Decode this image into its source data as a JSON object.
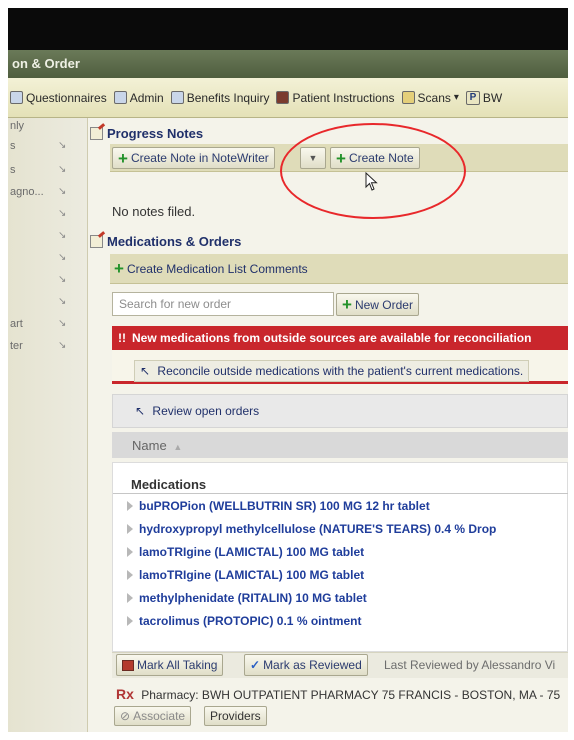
{
  "window": {
    "title": "on & Order"
  },
  "toolbar": {
    "items": [
      {
        "label": "Questionnaires",
        "icon": "questionnaire-icon"
      },
      {
        "label": "Admin",
        "icon": "admin-icon"
      },
      {
        "label": "Benefits Inquiry",
        "icon": "benefits-icon"
      },
      {
        "label": "Patient Instructions",
        "icon": "patient-instructions-icon"
      },
      {
        "label": "Scans",
        "icon": "scans-icon"
      },
      {
        "label": "BW",
        "icon": "p-icon"
      }
    ],
    "scans_caret": "▾",
    "p_letter": "P"
  },
  "sidebar": {
    "items": [
      {
        "label": "nly",
        "arrow": ""
      },
      {
        "label": "s",
        "arrow": "↘"
      },
      {
        "label": "s",
        "arrow": "↘"
      },
      {
        "label": "agno...",
        "arrow": "↘"
      },
      {
        "label": "",
        "arrow": "↘"
      },
      {
        "label": "",
        "arrow": "↘"
      },
      {
        "label": "",
        "arrow": "↘"
      },
      {
        "label": "",
        "arrow": "↘"
      },
      {
        "label": "",
        "arrow": "↘"
      },
      {
        "label": "art",
        "arrow": "↘"
      },
      {
        "label": "ter",
        "arrow": "↘"
      }
    ]
  },
  "progress_notes": {
    "header": "Progress Notes",
    "create_note_writer": "Create Note in NoteWriter",
    "create_note": "Create Note",
    "empty_text": "No notes filed."
  },
  "meds_orders": {
    "header": "Medications & Orders",
    "create_comments": "Create Medication List Comments",
    "search_placeholder": "Search for new order",
    "new_order": "New Order",
    "alert_icon": "!!",
    "alert_text": "New medications from outside sources are available for reconciliation",
    "reconcile_link": "Reconcile outside medications with the patient's current medications.",
    "review_link": "Review open orders",
    "name_column": "Name",
    "list_header": "Medications",
    "medications": [
      "buPROPion (WELLBUTRIN SR) 100 MG 12 hr tablet",
      "hydroxypropyl methylcellulose (NATURE'S TEARS) 0.4 % Drop",
      "lamoTRIgine (LAMICTAL) 100 MG tablet",
      "lamoTRIgine (LAMICTAL) 100 MG tablet",
      "methylphenidate (RITALIN) 10 MG tablet",
      "tacrolimus (PROTOPIC) 0.1 % ointment"
    ],
    "mark_all_taking": "Mark All Taking",
    "mark_as_reviewed": "Mark as Reviewed",
    "last_reviewed": "Last Reviewed by Alessandro Vi",
    "pharmacy": "Pharmacy: BWH OUTPATIENT PHARMACY 75 FRANCIS - BOSTON, MA - 75",
    "rx_symbol": "Rx",
    "associate": "Associate",
    "providers": "Providers"
  },
  "colors": {
    "alert": "#c9262c",
    "link": "#1f3d9b",
    "title_bar": "#5b6b48",
    "annotation": "#e8282b"
  }
}
